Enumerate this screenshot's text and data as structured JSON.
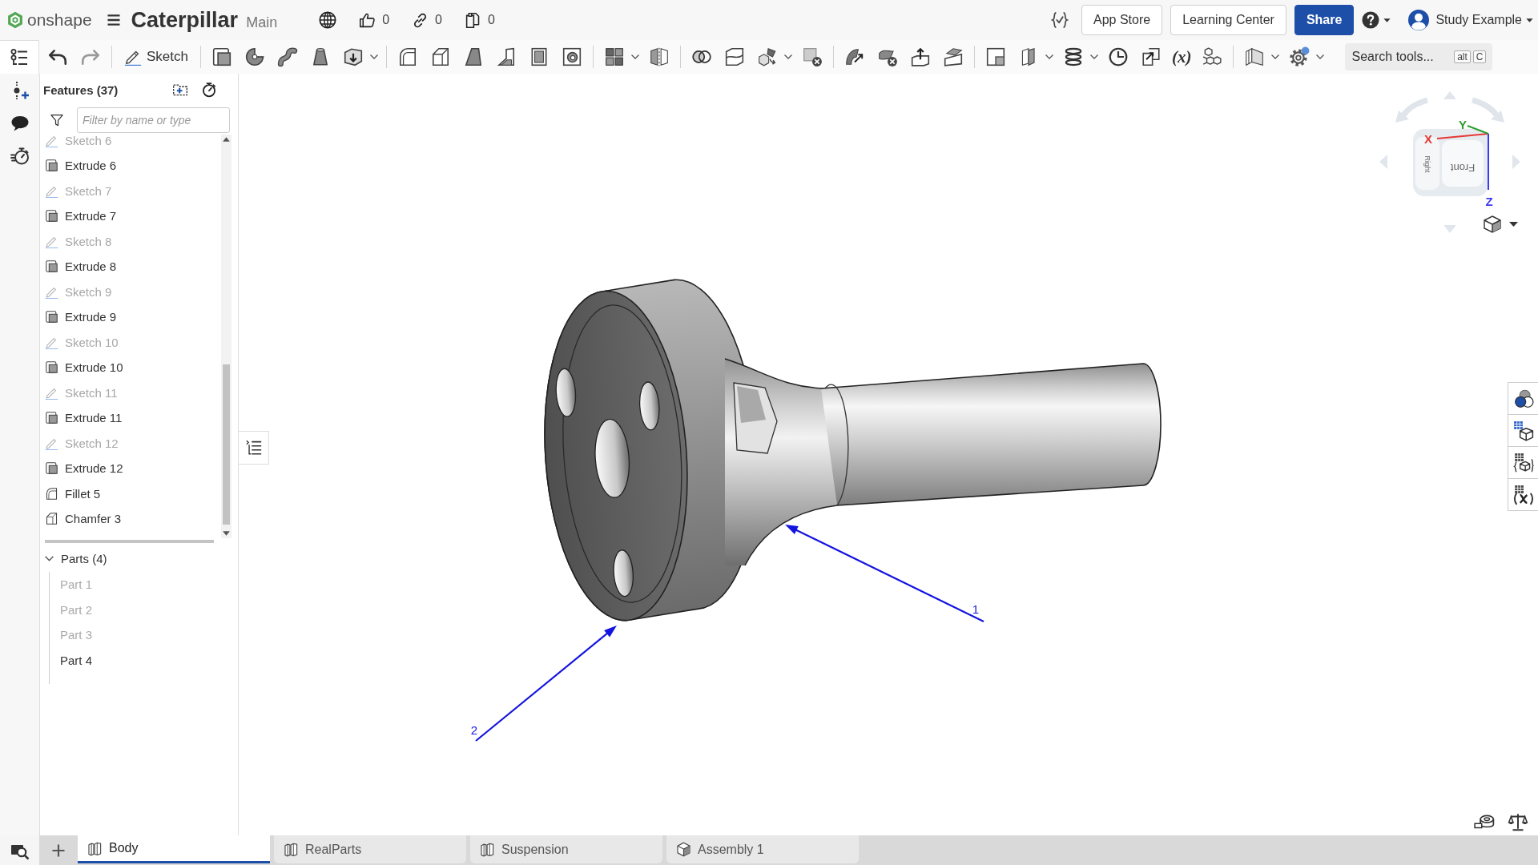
{
  "header": {
    "brand": "onshape",
    "document_title": "Caterpillar",
    "branch": "Main",
    "stats": [
      {
        "kind": "likes",
        "count": "0"
      },
      {
        "kind": "links",
        "count": "0"
      },
      {
        "kind": "copies",
        "count": "0"
      }
    ],
    "buttons": [
      {
        "kind": "plain",
        "label": "App Store"
      },
      {
        "kind": "plain",
        "label": "Learning Center"
      },
      {
        "kind": "primary",
        "label": "Share"
      }
    ],
    "user_name": "Study Example"
  },
  "toolbar": {
    "sketch_label": "Sketch",
    "variables_label": "(x)",
    "search": {
      "placeholder": "Search tools...",
      "keys": [
        "alt",
        "C"
      ]
    }
  },
  "feature_panel": {
    "title": "Features (37)",
    "filter": {
      "placeholder": "Filter by name or type"
    },
    "items": [
      {
        "kind": "sketch",
        "label": "Sketch 6",
        "hidden": true
      },
      {
        "kind": "extrude",
        "label": "Extrude 6",
        "hidden": false
      },
      {
        "kind": "sketch",
        "label": "Sketch 7",
        "hidden": true
      },
      {
        "kind": "extrude",
        "label": "Extrude 7",
        "hidden": false
      },
      {
        "kind": "sketch",
        "label": "Sketch 8",
        "hidden": true
      },
      {
        "kind": "extrude",
        "label": "Extrude 8",
        "hidden": false
      },
      {
        "kind": "sketch",
        "label": "Sketch 9",
        "hidden": true
      },
      {
        "kind": "extrude",
        "label": "Extrude 9",
        "hidden": false
      },
      {
        "kind": "sketch",
        "label": "Sketch 10",
        "hidden": true
      },
      {
        "kind": "extrude",
        "label": "Extrude 10",
        "hidden": false
      },
      {
        "kind": "sketch",
        "label": "Sketch 11",
        "hidden": true
      },
      {
        "kind": "extrude",
        "label": "Extrude 11",
        "hidden": false
      },
      {
        "kind": "sketch",
        "label": "Sketch 12",
        "hidden": true
      },
      {
        "kind": "extrude",
        "label": "Extrude 12",
        "hidden": false
      },
      {
        "kind": "fillet",
        "label": "Fillet 5",
        "hidden": false
      },
      {
        "kind": "chamfer",
        "label": "Chamfer 3",
        "hidden": false
      }
    ]
  },
  "parts": {
    "title": "Parts (4)",
    "expanded": true,
    "items": [
      {
        "label": "Part 1",
        "hidden": true
      },
      {
        "label": "Part 2",
        "hidden": true
      },
      {
        "label": "Part 3",
        "hidden": true
      },
      {
        "label": "Part 4",
        "hidden": false
      }
    ]
  },
  "viewport": {
    "view_cube": {
      "faces": [
        "Front",
        "Right"
      ],
      "axes": [
        {
          "label": "X",
          "color": "#e53935"
        },
        {
          "label": "Y",
          "color": "#2e9e2e"
        },
        {
          "label": "Z",
          "color": "#3a3af0"
        }
      ]
    },
    "callouts": [
      {
        "label": "1"
      },
      {
        "label": "2"
      }
    ]
  },
  "tabs": [
    {
      "kind": "part_studio",
      "label": "Body",
      "selected": true
    },
    {
      "kind": "part_studio",
      "label": "RealParts",
      "selected": false
    },
    {
      "kind": "part_studio",
      "label": "Suspension",
      "selected": false
    },
    {
      "kind": "assembly",
      "label": "Assembly 1",
      "selected": false
    }
  ]
}
